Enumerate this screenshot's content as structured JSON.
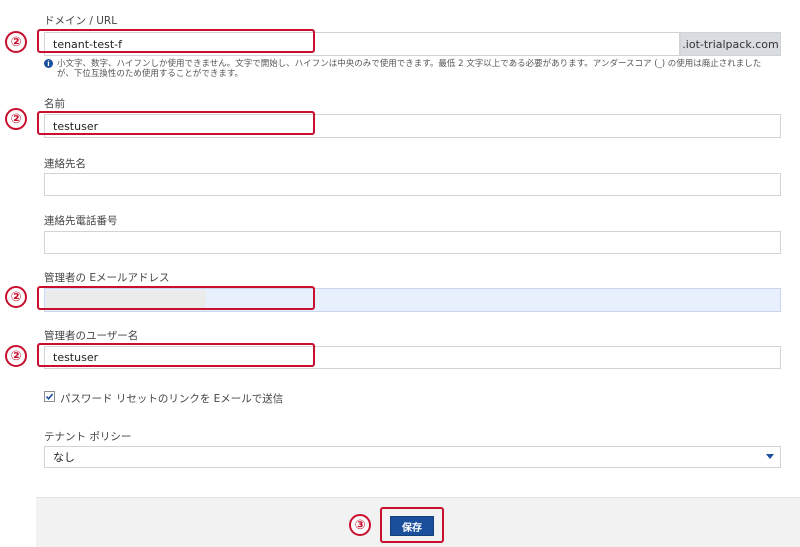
{
  "form": {
    "domain": {
      "label": "ドメイン / URL",
      "value": "tenant-test-f",
      "suffix": ".iot-trialpack.com",
      "help_line1": "小文字、数字、ハイフンしか使用できません。文字で開始し、ハイフンは中央のみで使用できます。最低 2 文字以上である必要があります。アンダースコア (_) の使用は廃止されました",
      "help_line2": "が、下位互換性のため使用することができます。"
    },
    "name": {
      "label": "名前",
      "value": "testuser"
    },
    "contact_name": {
      "label": "連絡先名",
      "value": ""
    },
    "contact_phone": {
      "label": "連絡先電話番号",
      "value": ""
    },
    "admin_email": {
      "label": "管理者の Eメールアドレス",
      "value": ""
    },
    "admin_username": {
      "label": "管理者のユーザー名",
      "value": "testuser"
    },
    "password_reset": {
      "label": "パスワード リセットのリンクを Eメールで送信",
      "checked": true
    },
    "tenant_policy": {
      "label": "テナント ポリシー",
      "value": "なし"
    }
  },
  "footer": {
    "save_label": "保存"
  },
  "annotations": {
    "step2": "②",
    "step3": "③"
  },
  "colors": {
    "highlight": "#c8102e",
    "primary": "#1a4f9c",
    "autofill": "#e8f0fe"
  }
}
